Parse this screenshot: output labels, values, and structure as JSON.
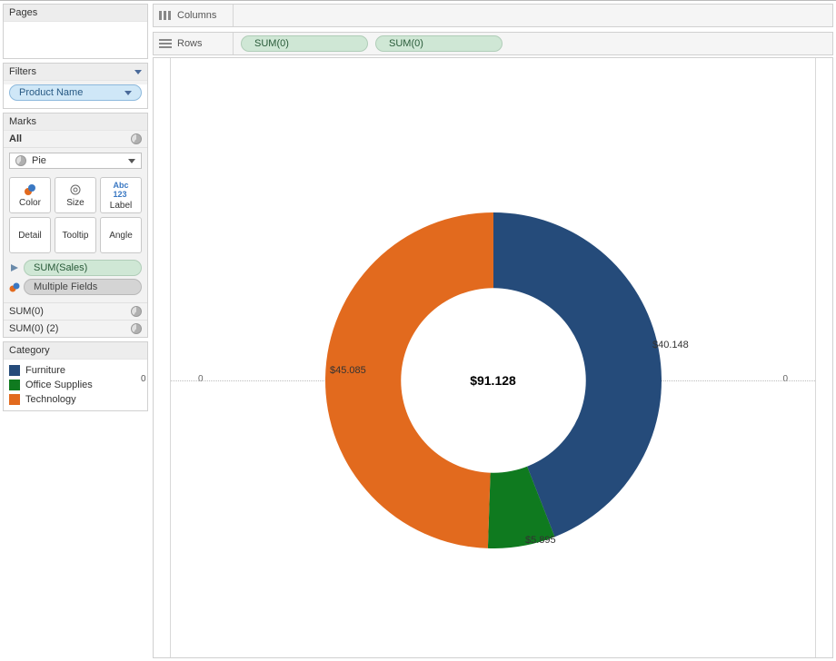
{
  "sidebar": {
    "pages_title": "Pages",
    "filters_title": "Filters",
    "filter_pill": "Product Name",
    "marks_title": "Marks",
    "marks_all": "All",
    "marktype": "Pie",
    "buttons": {
      "color": "Color",
      "size": "Size",
      "label": "Label",
      "detail": "Detail",
      "tooltip": "Tooltip",
      "angle": "Angle"
    },
    "pill_sum_sales": "SUM(Sales)",
    "pill_multiple": "Multiple Fields",
    "sum0": "SUM(0)",
    "sum0_2": "SUM(0) (2)",
    "category_title": "Category",
    "legend": [
      {
        "label": "Furniture",
        "color": "#254b7a"
      },
      {
        "label": "Office Supplies",
        "color": "#0f7a1f"
      },
      {
        "label": "Technology",
        "color": "#e26a1e"
      }
    ]
  },
  "shelves": {
    "columns": "Columns",
    "rows": "Rows",
    "row_pill1": "SUM(0)",
    "row_pill2": "SUM(0)"
  },
  "axis": {
    "zero": "0"
  },
  "chart_data": {
    "type": "pie",
    "title": "",
    "total_label": "$91.128",
    "series": [
      {
        "name": "Furniture",
        "value": 40.148,
        "label": "$40.148",
        "color": "#254b7a"
      },
      {
        "name": "Office Supplies",
        "value": 5.895,
        "label": "$5.895",
        "color": "#0f7a1f"
      },
      {
        "name": "Technology",
        "value": 45.085,
        "label": "$45.085",
        "color": "#e26a1e"
      }
    ]
  }
}
